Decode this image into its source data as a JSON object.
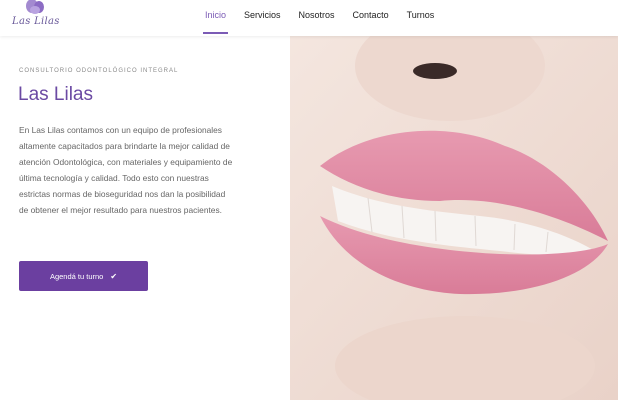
{
  "brand": {
    "logo_text": "Las Lilas",
    "accent_color": "#6b3fa0"
  },
  "nav": {
    "items": [
      {
        "label": "Inicio",
        "active": true
      },
      {
        "label": "Servicios",
        "active": false
      },
      {
        "label": "Nosotros",
        "active": false
      },
      {
        "label": "Contacto",
        "active": false
      },
      {
        "label": "Turnos",
        "active": false
      }
    ]
  },
  "hero": {
    "kicker": "CONSULTORIO ODONTOLÓGICO INTEGRAL",
    "title": "Las Lilas",
    "description": "En Las Lilas contamos con un equipo de profesionales altamente capacitados para brindarte la mejor calidad de atención Odontológica, con materiales y equipamiento de última tecnología y calidad. Todo esto con nuestras estrictas normas de bioseguridad nos dan la posibilidad de obtener el mejor resultado para nuestros pacientes.",
    "cta_label": "Agendá tu turno",
    "cta_icon": "check-icon"
  }
}
